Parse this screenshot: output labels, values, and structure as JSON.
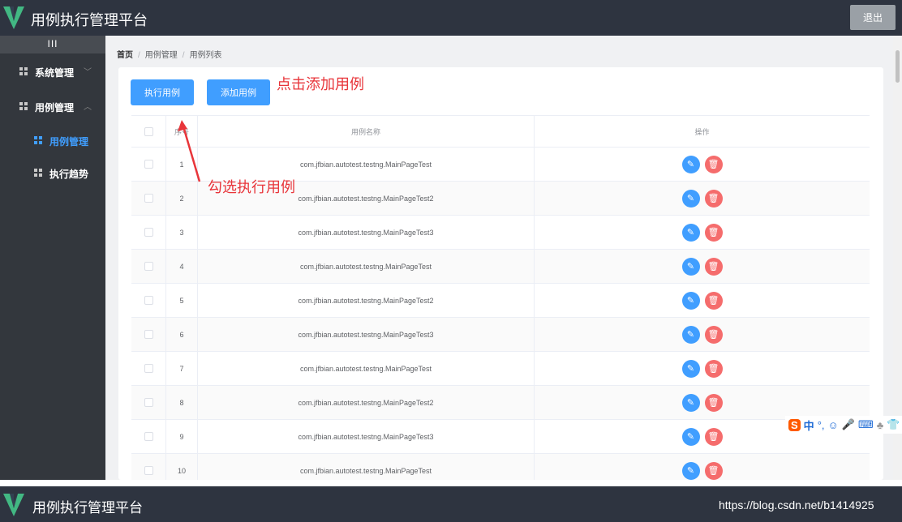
{
  "header": {
    "title": "用例执行管理平台",
    "logout_label": "退出"
  },
  "sidebar": {
    "collapse_label": "III",
    "items": [
      {
        "label": "系统管理",
        "chevron": "﹀"
      },
      {
        "label": "用例管理",
        "chevron": "︿"
      },
      {
        "label": "用例管理"
      },
      {
        "label": "执行趋势"
      }
    ],
    "active_item": "用例管理",
    "accent_color": "#409eff"
  },
  "breadcrumb": {
    "home": "首页",
    "sep": "/",
    "level1": "用例管理",
    "level2": "用例列表"
  },
  "toolbar": {
    "execute_label": "执行用例",
    "add_label": "添加用例"
  },
  "annotations": {
    "add_hint": "点击添加用例",
    "select_hint": "勾选执行用例"
  },
  "table": {
    "columns": {
      "index": "序号",
      "name": "用例名称",
      "ops": "操作"
    },
    "rows": [
      {
        "index": "1",
        "name": "com.jfbian.autotest.testng.MainPageTest"
      },
      {
        "index": "2",
        "name": "com.jfbian.autotest.testng.MainPageTest2"
      },
      {
        "index": "3",
        "name": "com.jfbian.autotest.testng.MainPageTest3"
      },
      {
        "index": "4",
        "name": "com.jfbian.autotest.testng.MainPageTest"
      },
      {
        "index": "5",
        "name": "com.jfbian.autotest.testng.MainPageTest2"
      },
      {
        "index": "6",
        "name": "com.jfbian.autotest.testng.MainPageTest3"
      },
      {
        "index": "7",
        "name": "com.jfbian.autotest.testng.MainPageTest"
      },
      {
        "index": "8",
        "name": "com.jfbian.autotest.testng.MainPageTest2"
      },
      {
        "index": "9",
        "name": "com.jfbian.autotest.testng.MainPageTest3"
      },
      {
        "index": "10",
        "name": "com.jfbian.autotest.testng.MainPageTest"
      }
    ]
  },
  "ime": {
    "logo": "S",
    "mode": "中",
    "punct": "°,"
  },
  "footer": {
    "title": "用例执行管理平台",
    "watermark": "https://blog.csdn.net/b1414925"
  }
}
